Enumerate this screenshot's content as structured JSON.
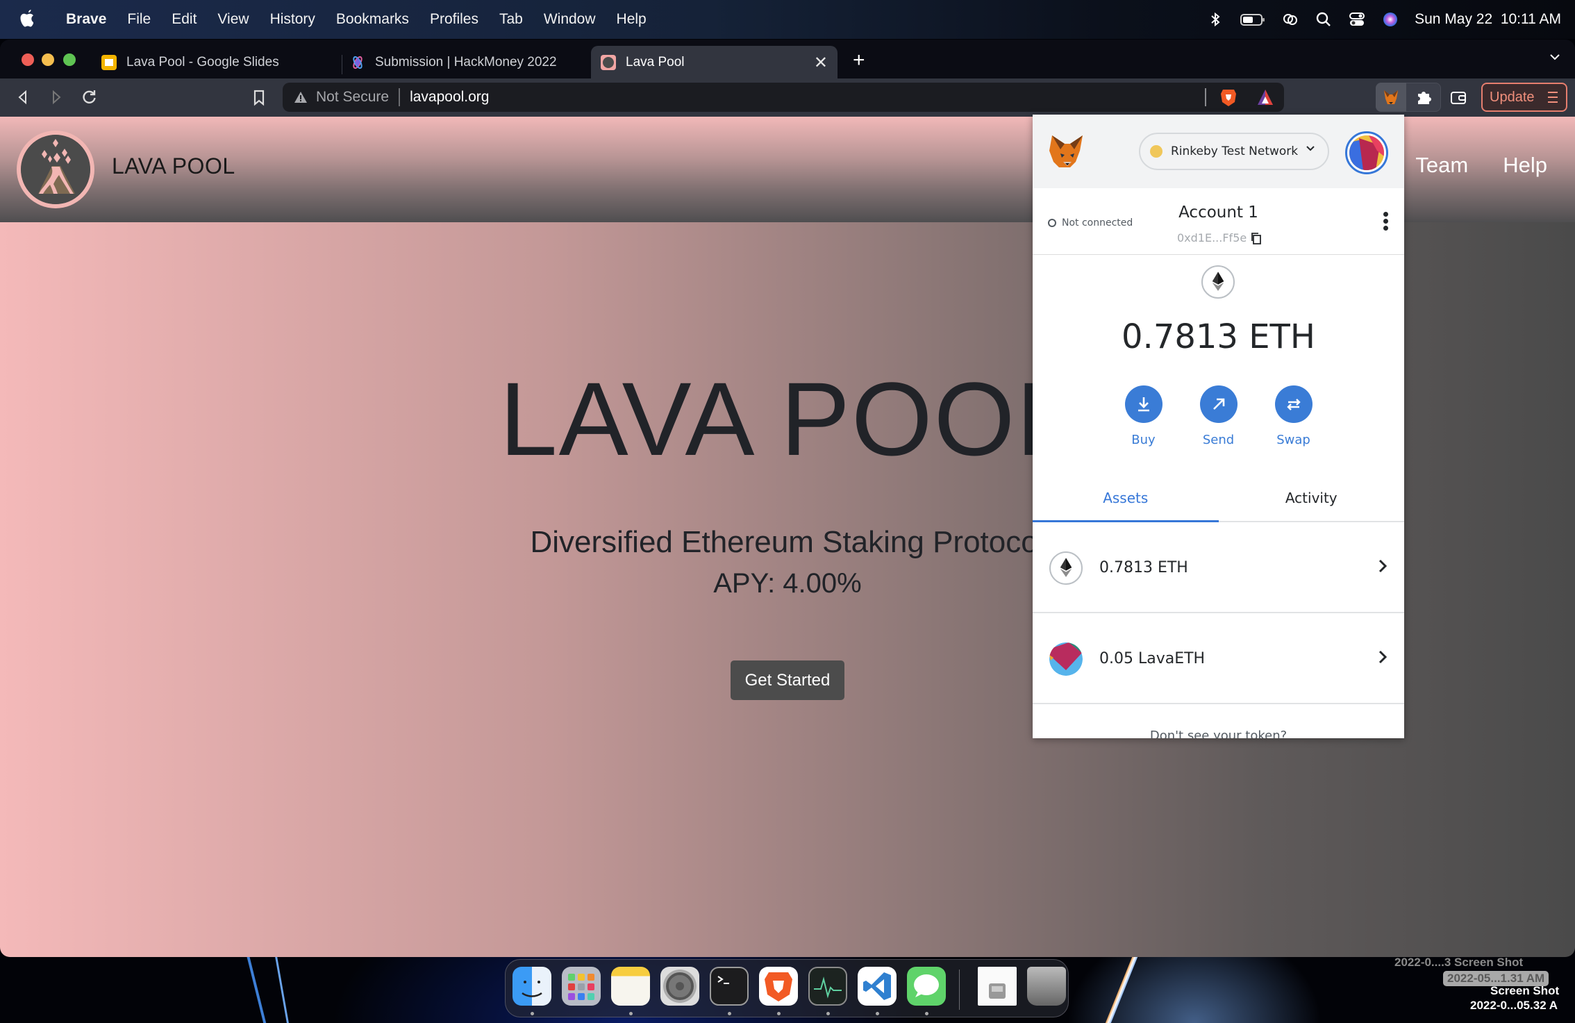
{
  "menubar": {
    "app_name": "Brave",
    "items": [
      "File",
      "Edit",
      "View",
      "History",
      "Bookmarks",
      "Profiles",
      "Tab",
      "Window",
      "Help"
    ],
    "clock": "Sun May 22  10:11 AM",
    "status_icons": [
      "bluetooth-icon",
      "battery-icon",
      "screen-mirroring-icon",
      "spotlight-search-icon",
      "control-center-icon",
      "siri-icon"
    ]
  },
  "browser": {
    "tabs": [
      {
        "title": "Lava Pool - Google Slides",
        "icon": "google-slides-icon",
        "active": false
      },
      {
        "title": "Submission | HackMoney 2022",
        "icon": "ethglobal-icon",
        "active": false
      },
      {
        "title": "Lava Pool",
        "icon": "lava-pool-favicon",
        "active": true
      }
    ],
    "close_glyph": "✕",
    "new_tab_glyph": "+",
    "tab_list_glyph": "⌄",
    "url_security": "Not Secure",
    "url": "lavapool.org",
    "update_label": "Update"
  },
  "site": {
    "brand": "LAVA POOL",
    "nav": [
      "Team",
      "Help"
    ],
    "hero_title": "LAVA POOL",
    "hero_subtitle": "Diversified Ethereum Staking Protocol",
    "apy_label": "APY: 4.00%",
    "cta_label": "Get Started"
  },
  "metamask": {
    "network": "Rinkeby Test Network",
    "network_color": "#f0c75a",
    "connection_status": "Not connected",
    "account_name": "Account 1",
    "account_address": "0xd1E...Ff5e",
    "balance": "0.7813 ETH",
    "accent_color": "#3677d8",
    "actions": [
      {
        "label": "Buy",
        "icon": "download-icon"
      },
      {
        "label": "Send",
        "icon": "arrow-up-right-icon"
      },
      {
        "label": "Swap",
        "icon": "swap-icon"
      }
    ],
    "tabs": [
      {
        "label": "Assets",
        "active": true
      },
      {
        "label": "Activity",
        "active": false
      }
    ],
    "assets": [
      {
        "amount": "0.7813 ETH",
        "icon": "ethereum-icon"
      },
      {
        "amount": "0.05 LavaETH",
        "icon": "lavaeth-token-icon"
      }
    ],
    "footer_hint": "Don't see your token?"
  },
  "dock": {
    "apps": [
      {
        "name": "Finder",
        "running": true
      },
      {
        "name": "Launchpad",
        "running": false
      },
      {
        "name": "Notes",
        "running": true
      },
      {
        "name": "System Preferences",
        "running": false
      },
      {
        "name": "Terminal",
        "running": true
      },
      {
        "name": "Brave Browser",
        "running": true
      },
      {
        "name": "Activity Monitor",
        "running": true
      },
      {
        "name": "Visual Studio Code",
        "running": true
      },
      {
        "name": "Messages",
        "running": true
      }
    ],
    "others": [
      "Downloads",
      "Trash"
    ]
  },
  "desktop": {
    "files": [
      {
        "line1": "2022-0....3 Screen Shot",
        "line2": "2022-05...1.31 AM"
      },
      {
        "line1": "Screen Shot",
        "line2": "2022-0...05.32 A"
      }
    ]
  }
}
